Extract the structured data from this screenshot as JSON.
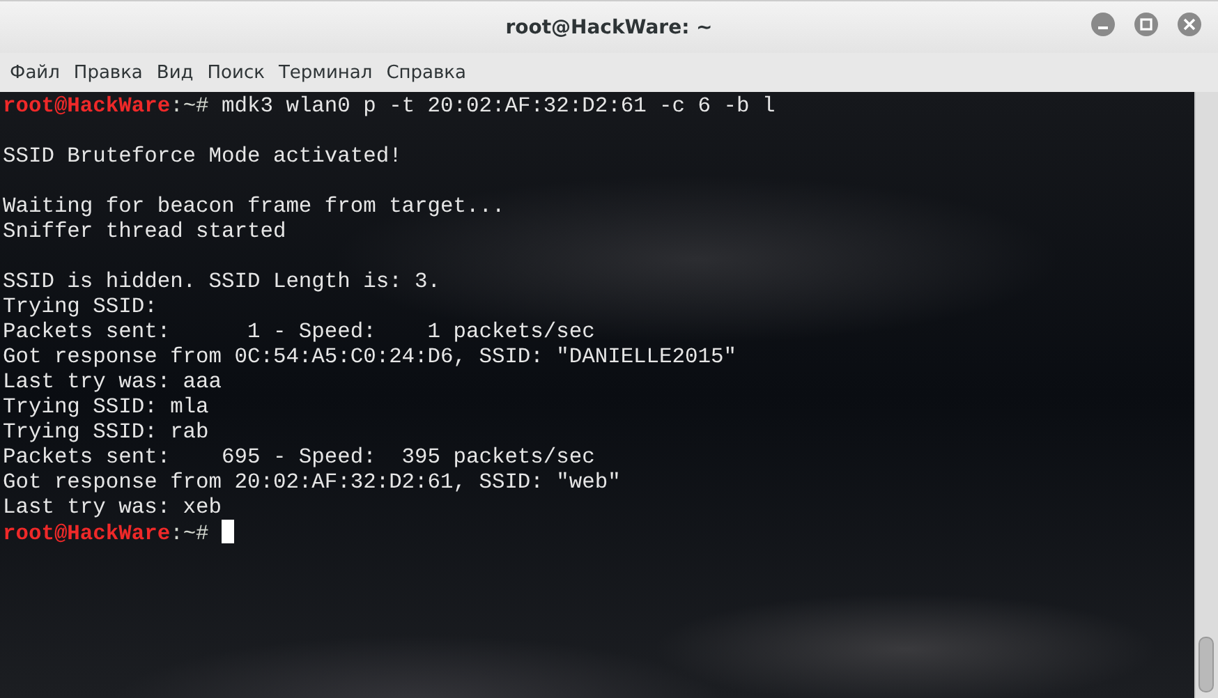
{
  "window": {
    "title": "root@HackWare: ~"
  },
  "menu": [
    "Файл",
    "Правка",
    "Вид",
    "Поиск",
    "Терминал",
    "Справка"
  ],
  "terminal": {
    "lines": [
      {
        "kind": "prompt",
        "user": "root@HackWare",
        "path": ":~#",
        "command": "mdk3 wlan0 p -t 20:02:AF:32:D2:61 -c 6 -b l"
      },
      {
        "kind": "blank"
      },
      {
        "kind": "output",
        "text": "SSID Bruteforce Mode activated!"
      },
      {
        "kind": "blank"
      },
      {
        "kind": "output",
        "text": "Waiting for beacon frame from target..."
      },
      {
        "kind": "output",
        "text": "Sniffer thread started"
      },
      {
        "kind": "blank"
      },
      {
        "kind": "output",
        "text": "SSID is hidden. SSID Length is: 3."
      },
      {
        "kind": "output",
        "text": "Trying SSID:"
      },
      {
        "kind": "output",
        "text": "Packets sent:      1 - Speed:    1 packets/sec"
      },
      {
        "kind": "output",
        "text": "Got response from 0C:54:A5:C0:24:D6, SSID: \"DANIELLE2015\""
      },
      {
        "kind": "output",
        "text": "Last try was: aaa"
      },
      {
        "kind": "output",
        "text": "Trying SSID: mla"
      },
      {
        "kind": "output",
        "text": "Trying SSID: rab"
      },
      {
        "kind": "output",
        "text": "Packets sent:    695 - Speed:  395 packets/sec"
      },
      {
        "kind": "output",
        "text": "Got response from 20:02:AF:32:D2:61, SSID: \"web\""
      },
      {
        "kind": "output",
        "text": "Last try was: xeb"
      },
      {
        "kind": "prompt",
        "user": "root@HackWare",
        "path": ":~#",
        "cursor": true
      }
    ]
  }
}
